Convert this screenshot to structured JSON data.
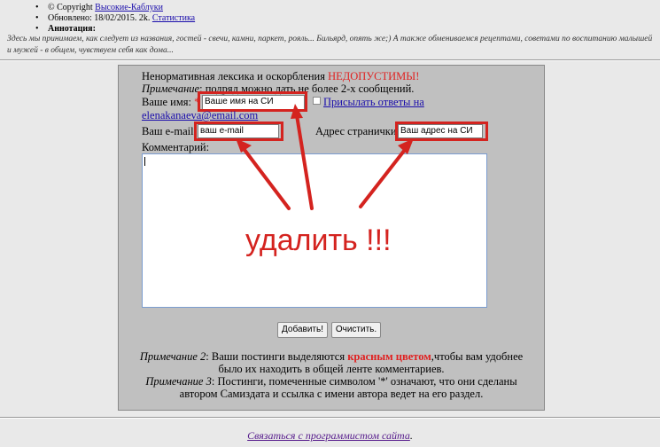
{
  "header": {
    "copyright_prefix": "© Copyright",
    "author_link": "Высокие-Каблуки",
    "updated_text": "Обновлено: 18/02/2015. 2k.",
    "stats_link": "Статистика",
    "annotation_label": "Аннотация:",
    "annotation_text": "Здесь мы принимаем, как следует из названия, гостей - свечи, камни, паркет, рояль... Бильярд, опять же;) А также обмениваемся рецептами, советами по воспитанию малышей и мужей - в общем, чувствуем себя как дома..."
  },
  "form": {
    "warning_text": "Ненормативная лексика и оскорбления",
    "warning_red": "НЕДОПУСТИМЫ!",
    "note1_label": "Примечание",
    "note1_text": ": подряд можно дать не более 2-х сообщений.",
    "name_label": "Ваше имя:",
    "required_mark": "*",
    "name_value": "Ваше имя на СИ",
    "send_replies_link": "Присылать ответы на",
    "email_link": "elenakanaeva@email.com",
    "email_label": "Ваш e-mail:",
    "email_value": "ваш e-mail",
    "site_label": "Адрес странички:",
    "site_value": "Ваш адрес на СИ",
    "comment_label": "Комментарий:",
    "comment_value": "",
    "add_button": "Добавить!",
    "clear_button": "Очистить."
  },
  "notes": {
    "note2_label": "Примечание 2",
    "note2_text_a": ": Ваши постинги выделяются",
    "note2_red": "красным цветом",
    "note2_text_b": ",чтобы вам удобнее",
    "note2_line2": "было их находить в общей ленте комментариев.",
    "note3_label": "Примечание 3",
    "note3_text": ": Постинги, помеченные символом '*' означают, что они сделаны",
    "note3_line2": "автором Самиздата и ссылка с имени автора ведет на его раздел."
  },
  "annotation_overlay": {
    "delete_text": "удалить !!!",
    "color": "#d4231f"
  },
  "footer": {
    "contact_link": "Связаться с программистом сайта",
    "contact_suffix": "."
  }
}
